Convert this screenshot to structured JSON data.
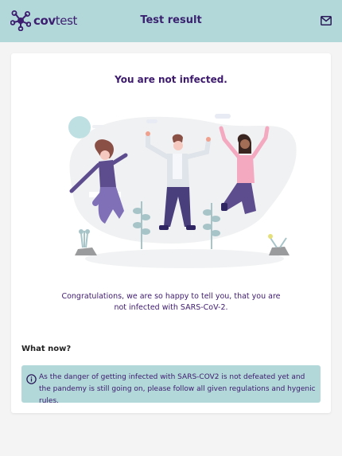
{
  "header": {
    "logo": {
      "brand_bold": "cov",
      "brand_light": "test"
    },
    "title": "Test result",
    "mail_icon": "envelope-icon"
  },
  "result": {
    "title": "You are not infected.",
    "illustration": "three-people-jumping-celebration",
    "message": "Congratulations, we are so happy to tell you, that you are not infected with SARS-CoV-2."
  },
  "what_now": {
    "heading": "What now?",
    "info_icon": "info-circle-icon",
    "text": "As the danger of getting infected with SARS-COV2 is not defeated yet and the pandemy is still going on, please follow all given regulations and hygenic rules."
  },
  "colors": {
    "header_bg": "#b2d8d9",
    "brand_purple": "#3d1e70",
    "page_bg": "#f4f4f5",
    "card_bg": "#ffffff"
  }
}
